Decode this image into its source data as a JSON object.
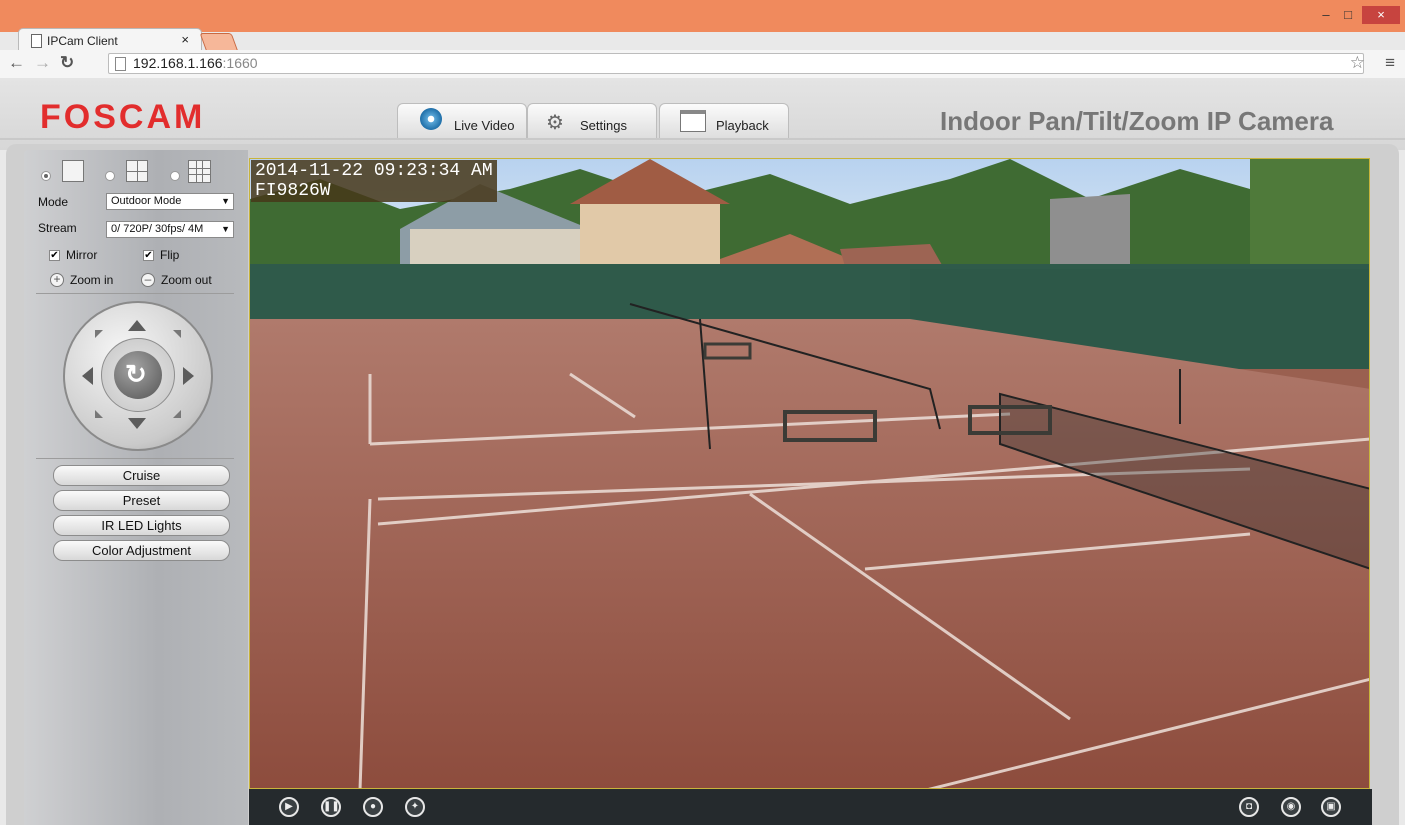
{
  "browser": {
    "tab_title": "IPCam Client",
    "tab_close": "×",
    "url_host": "192.168.1.166",
    "url_port": ":1660",
    "window_minimize": "–",
    "window_maximize": "□",
    "window_close": "×"
  },
  "header": {
    "logo": "FOSCAM",
    "product_title": "Indoor Pan/Tilt/Zoom IP Camera",
    "tabs": [
      {
        "label": "Live Video",
        "icon": "webcam-icon"
      },
      {
        "label": "Settings",
        "icon": "gears-icon"
      },
      {
        "label": "Playback",
        "icon": "calendar-icon"
      }
    ]
  },
  "sidebar": {
    "layouts": [
      "single-view",
      "quad-view",
      "nine-view"
    ],
    "selected_layout": "single-view",
    "mode_label": "Mode",
    "mode_value": "Outdoor Mode",
    "stream_label": "Stream",
    "stream_value": "0/ 720P/ 30fps/ 4M",
    "mirror_label": "Mirror",
    "mirror_checked": true,
    "flip_label": "Flip",
    "flip_checked": true,
    "zoom_in_label": "Zoom in",
    "zoom_out_label": "Zoom out",
    "buttons": [
      "Cruise",
      "Preset",
      "IR LED Lights",
      "Color Adjustment"
    ]
  },
  "video": {
    "timestamp": "2014-11-22 09:23:34 AM",
    "device_name": "FI9826W"
  },
  "colors": {
    "titlebar": "#f08a5d",
    "logo_red": "#e22d2d",
    "video_border": "#c8b43c",
    "control_bar": "#252a2d"
  }
}
